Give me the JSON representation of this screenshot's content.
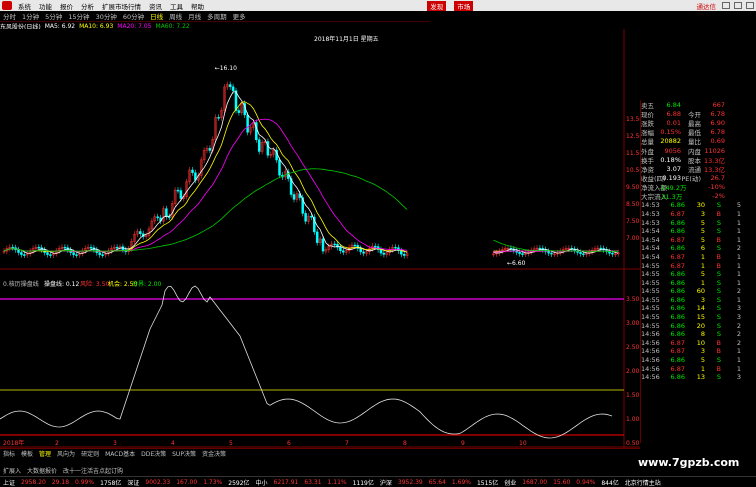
{
  "menu": {
    "items": [
      "系统",
      "功能",
      "报价",
      "分析",
      "扩展市场行情",
      "资讯",
      "工具",
      "帮助"
    ],
    "active": [
      "发现",
      "市场"
    ],
    "brand": "通达信"
  },
  "periods": {
    "items": [
      "分时",
      "1分钟",
      "5分钟",
      "15分钟",
      "30分钟",
      "60分钟",
      "日线",
      "周线",
      "月线",
      "多周期",
      "更多"
    ],
    "active_index": 6
  },
  "title": {
    "stock": "东风股份(日线)",
    "ma5": "MA5: 6.92",
    "ma10": "MA10: 6.93",
    "ma20": "MA20: 7.05",
    "ma60": "MA60: 7.22"
  },
  "chart_labels": {
    "date_tag": "2018年11月1日 星期五",
    "high_label": "16.10",
    "low_label": "6.60",
    "indicator_title": "0.核历操盘线",
    "indicator_main": "操盘线: 0.12",
    "indicator_red": "风险: 3.50",
    "indicator_yel": "机会: 2.50",
    "indicator_grn": "分界: 2.00",
    "year_label": "2018年"
  },
  "price_axis": [
    "13.50",
    "12.50",
    "11.50",
    "10.50",
    "9.50",
    "8.50",
    "7.50",
    "7.00"
  ],
  "ind_axis": [
    "3.50",
    "3.00",
    "2.50",
    "2.00",
    "1.50",
    "1.00",
    "0.50"
  ],
  "month_ticks": [
    "2",
    "3",
    "4",
    "5",
    "6",
    "7",
    "8",
    "9",
    "10"
  ],
  "quote": {
    "top_rows": [
      {
        "k": "卖五",
        "v": "6.84",
        "c": "grn",
        "v2": "667"
      },
      {
        "k": "现价",
        "v": "6.88",
        "c": "red",
        "k2": "今开",
        "v2": "6.78"
      },
      {
        "k": "涨跌",
        "v": "0.01",
        "c": "red",
        "k2": "最高",
        "v2": "6.90"
      },
      {
        "k": "涨幅",
        "v": "0.15%",
        "c": "red",
        "k2": "最低",
        "v2": "6.78"
      },
      {
        "k": "总量",
        "v": "20882",
        "c": "yel",
        "k2": "量比",
        "v2": "0.69"
      },
      {
        "k": "外盘",
        "v": "9056",
        "c": "red",
        "k2": "内盘",
        "v2": "11026"
      },
      {
        "k": "换手",
        "v": "0.18%",
        "c": "wht",
        "k2": "股本",
        "v2": "13.3亿"
      },
      {
        "k": "净资",
        "v": "3.07",
        "c": "wht",
        "k2": "流通",
        "v2": "13.3亿"
      },
      {
        "k": "收益(四)",
        "v": "0.193",
        "c": "wht",
        "k2": "PE(动)",
        "v2": "26.7"
      },
      {
        "k": "净流入额",
        "v": "-149.2万",
        "c": "grn",
        "v2": "-10%"
      },
      {
        "k": "大宗流入",
        "v": "-31.3万",
        "c": "grn",
        "v2": "-2%"
      }
    ],
    "ticks": [
      {
        "t": "14:53",
        "p": "6.86",
        "v": "30",
        "s": "S",
        "n": "5"
      },
      {
        "t": "14:53",
        "p": "6.87",
        "v": "3",
        "s": "B",
        "n": "1"
      },
      {
        "t": "14:53",
        "p": "6.86",
        "v": "5",
        "s": "S",
        "n": "1"
      },
      {
        "t": "14:54",
        "p": "6.86",
        "v": "5",
        "s": "S",
        "n": "1"
      },
      {
        "t": "14:54",
        "p": "6.87",
        "v": "5",
        "s": "B",
        "n": "1"
      },
      {
        "t": "14:54",
        "p": "6.86",
        "v": "6",
        "s": "S",
        "n": "2"
      },
      {
        "t": "14:54",
        "p": "6.87",
        "v": "1",
        "s": "B",
        "n": "1"
      },
      {
        "t": "14:55",
        "p": "6.87",
        "v": "1",
        "s": "B",
        "n": "1"
      },
      {
        "t": "14:55",
        "p": "6.86",
        "v": "5",
        "s": "S",
        "n": "1"
      },
      {
        "t": "14:55",
        "p": "6.86",
        "v": "1",
        "s": "S",
        "n": "1"
      },
      {
        "t": "14:55",
        "p": "6.86",
        "v": "60",
        "s": "S",
        "n": "2"
      },
      {
        "t": "14:55",
        "p": "6.86",
        "v": "3",
        "s": "S",
        "n": "1"
      },
      {
        "t": "14:55",
        "p": "6.86",
        "v": "14",
        "s": "S",
        "n": "3"
      },
      {
        "t": "14:55",
        "p": "6.86",
        "v": "15",
        "s": "S",
        "n": "3"
      },
      {
        "t": "14:55",
        "p": "6.86",
        "v": "20",
        "s": "S",
        "n": "2"
      },
      {
        "t": "14:56",
        "p": "6.86",
        "v": "8",
        "s": "S",
        "n": "2"
      },
      {
        "t": "14:56",
        "p": "6.87",
        "v": "10",
        "s": "B",
        "n": "2"
      },
      {
        "t": "14:56",
        "p": "6.87",
        "v": "3",
        "s": "B",
        "n": "1"
      },
      {
        "t": "14:56",
        "p": "6.86",
        "v": "5",
        "s": "S",
        "n": "1"
      },
      {
        "t": "14:56",
        "p": "6.87",
        "v": "1",
        "s": "B",
        "n": "1"
      },
      {
        "t": "14:56",
        "p": "6.86",
        "v": "13",
        "s": "S",
        "n": "3"
      }
    ]
  },
  "bottom_tabs": [
    "指标",
    "模板",
    "管理",
    "风向为",
    "研定则",
    "MACD基本",
    "DDE决策",
    "SUP决策",
    "资金决策"
  ],
  "bottom_tabs_active": 2,
  "bottom_tabs2": [
    "扩展入",
    "大数据报价",
    "改十一注活吉点起订购"
  ],
  "status": [
    {
      "label": "上证",
      "v": "2958.20",
      "c": "red"
    },
    {
      "label": "",
      "v": "29.18",
      "c": "red"
    },
    {
      "label": "",
      "v": "0.99%",
      "c": "red"
    },
    {
      "label": "",
      "v": "1758亿",
      "c": "wht"
    },
    {
      "label": "深证",
      "v": "9002.33",
      "c": "red"
    },
    {
      "label": "",
      "v": "167.00",
      "c": "red"
    },
    {
      "label": "",
      "v": "1.73%",
      "c": "red"
    },
    {
      "label": "",
      "v": "2592亿",
      "c": "wht"
    },
    {
      "label": "中小",
      "v": "6217.91",
      "c": "red"
    },
    {
      "label": "",
      "v": "63.31",
      "c": "red"
    },
    {
      "label": "",
      "v": "1.11%",
      "c": "red"
    },
    {
      "label": "",
      "v": "1119亿",
      "c": "wht"
    },
    {
      "label": "沪深",
      "v": "3952.39",
      "c": "red"
    },
    {
      "label": "",
      "v": "65.64",
      "c": "red"
    },
    {
      "label": "",
      "v": "1.69%",
      "c": "red"
    },
    {
      "label": "",
      "v": "1515亿",
      "c": "wht"
    },
    {
      "label": "创业",
      "v": "1687.00",
      "c": "red"
    },
    {
      "label": "",
      "v": "15.60",
      "c": "red"
    },
    {
      "label": "",
      "v": "0.94%",
      "c": "red"
    },
    {
      "label": "",
      "v": "844亿",
      "c": "wht"
    },
    {
      "label": "北京行情主站",
      "v": "",
      "c": "wht"
    }
  ],
  "watermark": "www.7gpzb.com",
  "colors": {
    "up": "#ff3232",
    "down": "#00ffff",
    "ma5": "#ffffff",
    "ma10": "#ffff00",
    "ma20": "#ff00ff",
    "ma60": "#00c800",
    "risk": "#cc00cc",
    "chance": "#b4b400",
    "bound": "#ff0000"
  }
}
